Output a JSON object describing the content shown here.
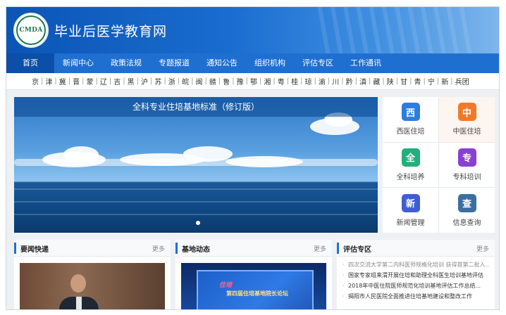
{
  "header": {
    "logo_text": "CMDA",
    "site_title": "毕业后医学教育网"
  },
  "nav": {
    "items": [
      {
        "label": "首页",
        "active": true
      },
      {
        "label": "新闻中心",
        "active": false
      },
      {
        "label": "政策法规",
        "active": false
      },
      {
        "label": "专题报道",
        "active": false
      },
      {
        "label": "通知公告",
        "active": false
      },
      {
        "label": "组织机构",
        "active": false
      },
      {
        "label": "评估专区",
        "active": false
      },
      {
        "label": "工作通讯",
        "active": false
      }
    ]
  },
  "provinces": [
    "京",
    "津",
    "冀",
    "晋",
    "蒙",
    "辽",
    "吉",
    "黑",
    "沪",
    "苏",
    "浙",
    "皖",
    "闽",
    "赣",
    "鲁",
    "豫",
    "鄂",
    "湘",
    "粤",
    "桂",
    "琼",
    "渝",
    "川",
    "黔",
    "滇",
    "藏",
    "陕",
    "甘",
    "青",
    "宁",
    "新",
    "兵团"
  ],
  "banner": {
    "caption": "全科专业住培基地标准（修订版）"
  },
  "quick_links": [
    {
      "icon_char": "西",
      "label": "西医住培",
      "color": "#2d7de0",
      "icon": "western-medicine-icon"
    },
    {
      "icon_char": "中",
      "label": "中医住培",
      "color": "#f07a2a",
      "icon": "chinese-medicine-icon"
    },
    {
      "icon_char": "全",
      "label": "全科培养",
      "color": "#21b07a",
      "icon": "general-practice-icon"
    },
    {
      "icon_char": "专",
      "label": "专科培训",
      "color": "#8a3fd1",
      "icon": "specialty-training-icon"
    },
    {
      "icon_char": "新",
      "label": "新闻管理",
      "color": "#3f5fd0",
      "icon": "news-management-icon"
    },
    {
      "icon_char": "查",
      "label": "信息查询",
      "color": "#3a6fa0",
      "icon": "info-query-icon"
    }
  ],
  "panels": {
    "news": {
      "title": "要闻快递",
      "more": "更多"
    },
    "base": {
      "title": "基地动态",
      "more": "更多",
      "screen_text": "第四届住培基地院长论坛",
      "screen_logo": "住培"
    },
    "eval": {
      "title": "评估专区",
      "more": "更多",
      "items": [
        "四次交流大学第二内科医师规格化培训 获得首第二批入...",
        "国家专家组来渭开展住培和助理全科医生培训基地评估",
        "2018年中医住院医师规范化培训基地评估工作总结...",
        "揭阳市人民医院全面推进住培基地建设和整改工作"
      ]
    }
  }
}
